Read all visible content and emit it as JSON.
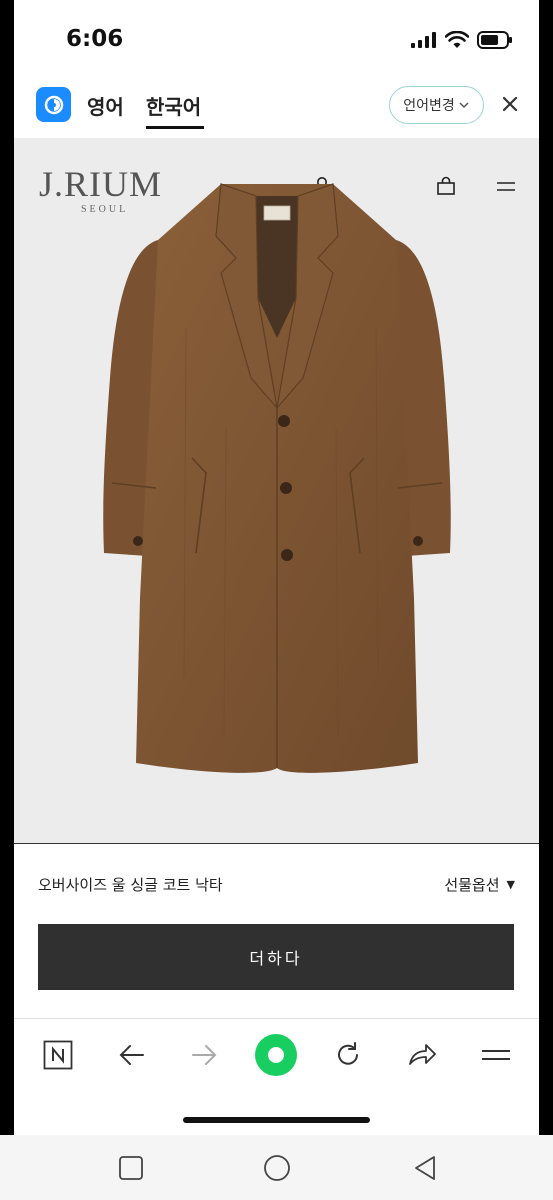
{
  "status_bar": {
    "time": "6:06"
  },
  "translate_bar": {
    "source_lang": "영어",
    "target_lang": "한국어",
    "change_label": "언어변경",
    "change_chevron": "⌄"
  },
  "site": {
    "logo": "J.RIUM",
    "logo_sub": "SEOUL",
    "header_icons": [
      "user-icon",
      "shopping-bag-icon",
      "menu-icon"
    ]
  },
  "product": {
    "name": "오버사이즈 울 싱글 코트 낙타",
    "option_label": "선물옵션",
    "option_caret": "▼",
    "add_button": "더하다",
    "image": "camel-coat"
  },
  "browser_toolbar": {
    "items": [
      "naver-icon",
      "back-icon",
      "forward-icon",
      "home-icon",
      "reload-icon",
      "share-icon",
      "menu-icon"
    ],
    "home_color": "#19ce60"
  },
  "android_nav": {
    "items": [
      "recents-icon",
      "home-icon",
      "back-icon"
    ]
  }
}
